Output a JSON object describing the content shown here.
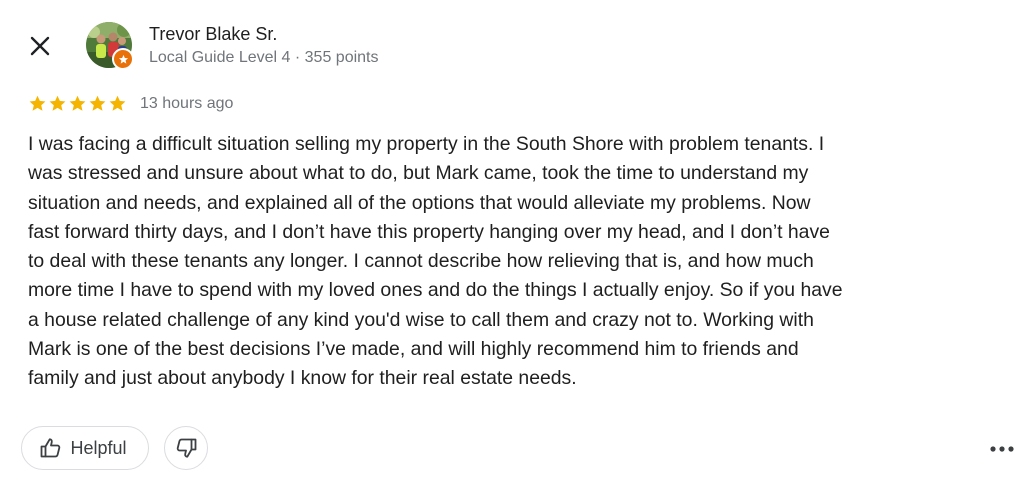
{
  "reviewer": {
    "name": "Trevor Blake Sr.",
    "meta": "Local Guide Level 4 · 355 points",
    "avatar_icon": "profile-photo",
    "badge_icon": "local-guide-star-icon"
  },
  "rating": {
    "stars": 5,
    "max_stars": 5,
    "star_color": "#f4b400",
    "timestamp": "13 hours ago"
  },
  "review": {
    "lines": [
      "I was facing a difficult situation selling my property in the South Shore with problem tenants. I",
      "was stressed and unsure about what to do, but Mark came, took the time to understand my",
      "situation and needs, and explained all of the options that would alleviate my problems. Now",
      "fast forward thirty days, and I don’t have this property hanging over my head, and I don’t have",
      "to deal with these tenants any longer. I cannot describe how relieving that is, and how much",
      "more time I have to spend with my loved ones and do the things I actually enjoy. So if you have",
      "a house related challenge of any kind you'd wise to call them and crazy not to. Working with",
      "Mark is one of the best decisions I’ve made, and will highly recommend him to friends and",
      "family and just about anybody I know for their real estate needs."
    ]
  },
  "actions": {
    "helpful_label": "Helpful",
    "helpful_icon": "thumbs-up-icon",
    "dislike_icon": "thumbs-down-icon",
    "more_icon": "more-options-icon",
    "close_icon": "close-icon"
  },
  "colors": {
    "text_primary": "#1f1f1f",
    "text_secondary": "#70757a",
    "badge": "#e8710a",
    "border": "#dadce0"
  }
}
